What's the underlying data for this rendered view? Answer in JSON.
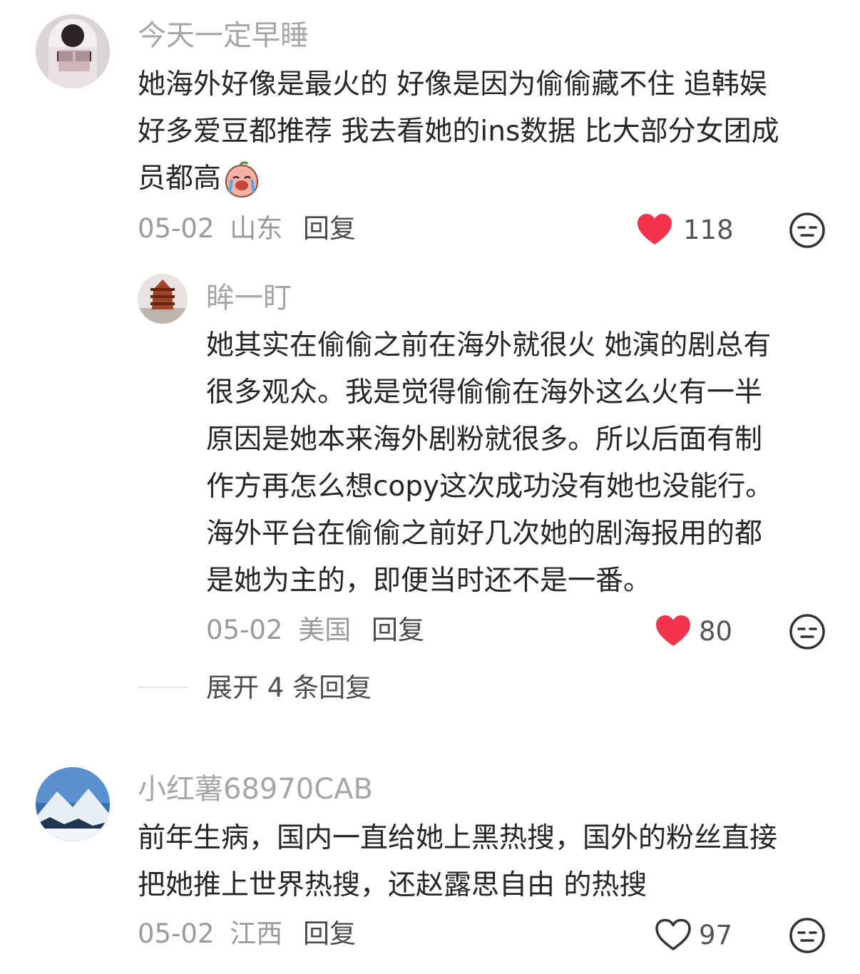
{
  "comments": [
    {
      "username": "今天一定早睡",
      "text_lines": [
        "她海外好像是最火的 好像是因为偷偷藏不住 追韩娱",
        "好多爱豆都推荐 我去看她的ins数据 比大部分女团成",
        "员都高"
      ],
      "date": "05-02",
      "location": "山东",
      "reply_label": "回复",
      "likes": "118",
      "liked": true,
      "emoji_icon": "crying-face-emoji-icon"
    },
    {
      "username": "眸一盯",
      "text_lines": [
        "她其实在偷偷之前在海外就很火 她演的剧总有",
        "很多观众。我是觉得偷偷在海外这么火有一半",
        "原因是她本来海外剧粉就很多。所以后面有制",
        "作方再怎么想copy这次成功没有她也没能行。",
        "海外平台在偷偷之前好几次她的剧海报用的都",
        "是她为主的，即便当时还不是一番。"
      ],
      "date": "05-02",
      "location": "美国",
      "reply_label": "回复",
      "likes": "80",
      "liked": true
    },
    {
      "username": "小红薯68970CAB",
      "text_lines": [
        "前年生病，国内一直给她上黑热搜，国外的粉丝直接",
        "把她推上世界热搜，还赵露思自由 的热搜"
      ],
      "date": "05-02",
      "location": "江西",
      "reply_label": "回复",
      "likes": "97",
      "liked": false
    }
  ],
  "expand_replies": "展开 4 条回复",
  "icons": {
    "heart_filled": "heart-filled-icon",
    "heart_outline": "heart-outline-icon",
    "dislike": "neutral-face-icon"
  },
  "colors": {
    "heart_red": "#f5334d",
    "username_gray": "#a6a6a6",
    "text_dark": "#262626"
  }
}
